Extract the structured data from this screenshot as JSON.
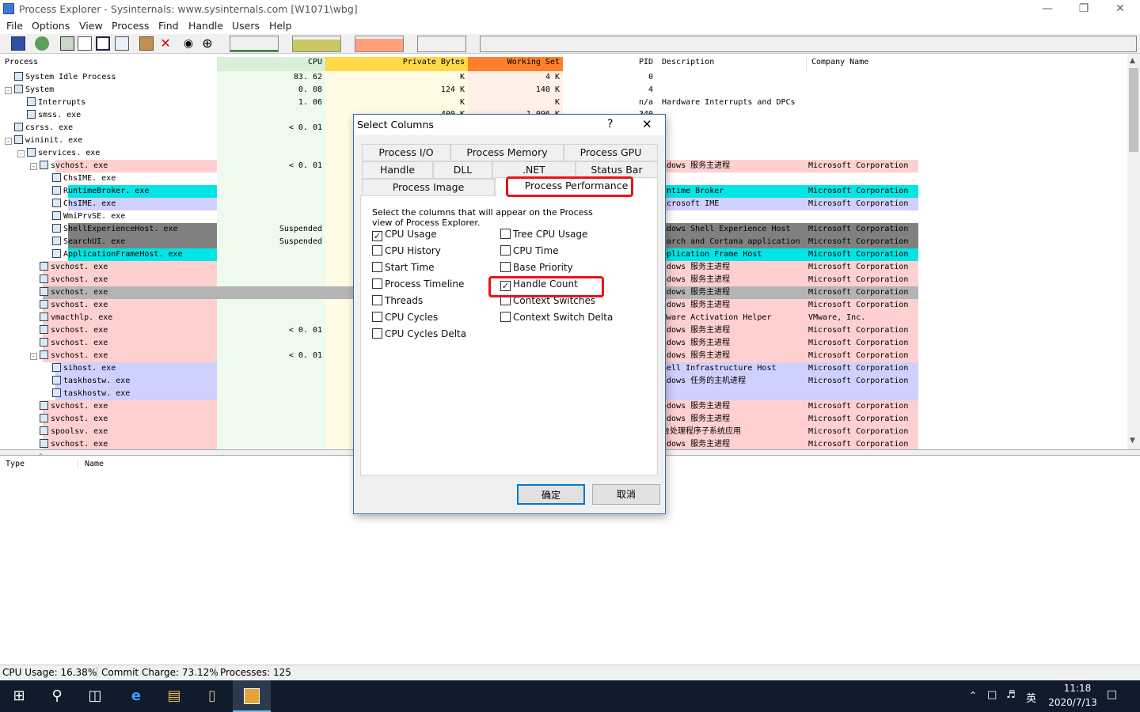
{
  "window": {
    "title": "Process Explorer - Sysinternals: www.sysinternals.com [W1071\\wbg]"
  },
  "menu": [
    "File",
    "Options",
    "View",
    "Process",
    "Find",
    "Handle",
    "Users",
    "Help"
  ],
  "columns": {
    "process": "Process",
    "cpu": "CPU",
    "private_bytes": "Private Bytes",
    "working_set": "Working Set",
    "pid": "PID",
    "description": "Description",
    "company": "Company Name"
  },
  "processes": [
    {
      "name": "System Idle Process",
      "cpu": "83. 62",
      "pb": "K",
      "ws": "4 K",
      "pid": "0",
      "desc": "",
      "co": ""
    },
    {
      "name": "System",
      "cpu": "0. 08",
      "pb": "124 K",
      "ws": "140 K",
      "pid": "4",
      "desc": "",
      "co": ""
    },
    {
      "name": "Interrupts",
      "cpu": "1. 06",
      "pb": "K",
      "ws": "K",
      "pid": "n/a",
      "desc": "Hardware Interrupts and DPCs",
      "co": ""
    },
    {
      "name": "smss. exe",
      "cpu": "",
      "pb": "",
      "ws": "",
      "pid": "",
      "desc": "",
      "co": ""
    },
    {
      "name": "csrss. exe",
      "cpu": "< 0. 01",
      "pb": "",
      "ws": "",
      "pid": "",
      "desc": "",
      "co": ""
    },
    {
      "name": "wininit. exe",
      "cpu": "",
      "pb": "",
      "ws": "",
      "pid": "",
      "desc": "",
      "co": ""
    },
    {
      "name": "services. exe",
      "cpu": "",
      "pb": "",
      "ws": "",
      "pid": "",
      "desc": "",
      "co": ""
    },
    {
      "name": "svchost. exe",
      "cpu": "< 0. 01",
      "pb": "",
      "ws": "",
      "pid": "",
      "desc": "ndows 服务主进程",
      "co": "Microsoft Corporation"
    },
    {
      "name": "ChsIME. exe",
      "cpu": "",
      "pb": "",
      "ws": "",
      "pid": "",
      "desc": "",
      "co": ""
    },
    {
      "name": "RuntimeBroker. exe",
      "cpu": "",
      "pb": "",
      "ws": "",
      "pid": "",
      "desc": "untime Broker",
      "co": "Microsoft Corporation"
    },
    {
      "name": "ChsIME. exe",
      "cpu": "",
      "pb": "",
      "ws": "",
      "pid": "",
      "desc": "icrosoft IME",
      "co": "Microsoft Corporation"
    },
    {
      "name": "WmiPrvSE. exe",
      "cpu": "",
      "pb": "",
      "ws": "",
      "pid": "",
      "desc": "",
      "co": ""
    },
    {
      "name": "ShellExperienceHost. exe",
      "cpu": "Suspended",
      "pb": "",
      "ws": "",
      "pid": "",
      "desc": "ndows Shell Experience Host",
      "co": "Microsoft Corporation"
    },
    {
      "name": "SearchUI. exe",
      "cpu": "Suspended",
      "pb": "",
      "ws": "",
      "pid": "",
      "desc": "earch and Cortana application",
      "co": "Microsoft Corporation"
    },
    {
      "name": "ApplicationFrameHost. exe",
      "cpu": "",
      "pb": "",
      "ws": "",
      "pid": "",
      "desc": "pplication Frame Host",
      "co": "Microsoft Corporation"
    },
    {
      "name": "svchost. exe",
      "cpu": "",
      "pb": "",
      "ws": "",
      "pid": "",
      "desc": "ndows 服务主进程",
      "co": "Microsoft Corporation"
    },
    {
      "name": "svchost. exe",
      "cpu": "",
      "pb": "",
      "ws": "",
      "pid": "",
      "desc": "ndows 服务主进程",
      "co": "Microsoft Corporation"
    },
    {
      "name": "svchost. exe",
      "cpu": "",
      "pb": "",
      "ws": "",
      "pid": "",
      "desc": "ndows 服务主进程",
      "co": "Microsoft Corporation"
    },
    {
      "name": "svchost. exe",
      "cpu": "",
      "pb": "",
      "ws": "",
      "pid": "",
      "desc": "ndows 服务主进程",
      "co": "Microsoft Corporation"
    },
    {
      "name": "vmacthlp. exe",
      "cpu": "",
      "pb": "",
      "ws": "",
      "pid": "",
      "desc": "Mware Activation Helper",
      "co": "VMware,  Inc."
    },
    {
      "name": "svchost. exe",
      "cpu": "< 0. 01",
      "pb": "",
      "ws": "",
      "pid": "",
      "desc": "ndows 服务主进程",
      "co": "Microsoft Corporation"
    },
    {
      "name": "svchost. exe",
      "cpu": "",
      "pb": "",
      "ws": "",
      "pid": "",
      "desc": "ndows 服务主进程",
      "co": "Microsoft Corporation"
    },
    {
      "name": "svchost. exe",
      "cpu": "< 0. 01",
      "pb": "",
      "ws": "",
      "pid": "",
      "desc": "ndows 服务主进程",
      "co": "Microsoft Corporation"
    },
    {
      "name": "sihost. exe",
      "cpu": "",
      "pb": "",
      "ws": "",
      "pid": "",
      "desc": "hell Infrastructure Host",
      "co": "Microsoft Corporation"
    },
    {
      "name": "taskhostw. exe",
      "cpu": "",
      "pb": "",
      "ws": "",
      "pid": "",
      "desc": "ndows 任务的主机进程",
      "co": "Microsoft Corporation"
    },
    {
      "name": "taskhostw. exe",
      "cpu": "",
      "pb": "",
      "ws": "",
      "pid": "",
      "desc": "",
      "co": ""
    },
    {
      "name": "svchost. exe",
      "cpu": "",
      "pb": "",
      "ws": "",
      "pid": "",
      "desc": "ndows 服务主进程",
      "co": "Microsoft Corporation"
    },
    {
      "name": "svchost. exe",
      "cpu": "",
      "pb": "",
      "ws": "",
      "pid": "",
      "desc": "ndows 服务主进程",
      "co": "Microsoft Corporation"
    },
    {
      "name": "spoolsv. exe",
      "cpu": "",
      "pb": "",
      "ws": "",
      "pid": "",
      "desc": "台处理程序子系统应用",
      "co": "Microsoft Corporation"
    },
    {
      "name": "svchost. exe",
      "cpu": "",
      "pb": "",
      "ws": "",
      "pid": "",
      "desc": "ndows 服务主进程",
      "co": "Microsoft Corporation"
    }
  ],
  "partial_row": {
    "pb": "400 K",
    "ws": "1,096 K",
    "pid": "340"
  },
  "lower": {
    "type": "Type",
    "name": "Name"
  },
  "status": {
    "cpu": "CPU Usage: 16.38%",
    "commit": "Commit Charge: 73.12%",
    "procs": "Processes: 125"
  },
  "dialog": {
    "title": "Select Columns",
    "help": "?",
    "close": "✕",
    "tabs_row1": [
      "Process I/O",
      "Process Memory",
      "Process GPU"
    ],
    "tabs_row2": [
      "Handle",
      "DLL",
      ".NET",
      "Status Bar"
    ],
    "tabs_row3": [
      "Process Image",
      "Process Performance"
    ],
    "intro": "Select the columns that will appear on the Process view of Process Explorer.",
    "left_options": [
      {
        "label": "CPU Usage",
        "checked": true
      },
      {
        "label": "CPU History",
        "checked": false
      },
      {
        "label": "Start Time",
        "checked": false
      },
      {
        "label": "Process Timeline",
        "checked": false
      },
      {
        "label": "Threads",
        "checked": false
      },
      {
        "label": "CPU Cycles",
        "checked": false
      },
      {
        "label": "CPU Cycles Delta",
        "checked": false
      }
    ],
    "right_options": [
      {
        "label": "Tree CPU Usage",
        "checked": false
      },
      {
        "label": "CPU Time",
        "checked": false
      },
      {
        "label": "Base Priority",
        "checked": false
      },
      {
        "label": "Handle Count",
        "checked": true
      },
      {
        "label": "Context Switches",
        "checked": false
      },
      {
        "label": "Context Switch Delta",
        "checked": false
      }
    ],
    "ok": "确定",
    "cancel": "取消"
  },
  "tray": {
    "time": "11:18",
    "date": "2020/7/13",
    "ime": "英"
  },
  "colors": {
    "service_pink": "#ffd0d0",
    "immersive_cyan": "#00e5e5",
    "own_lavender": "#d0d0ff",
    "suspended_gray": "#808080",
    "selected_gray": "#b4b4b4",
    "highlight_red": "#e8141c"
  }
}
